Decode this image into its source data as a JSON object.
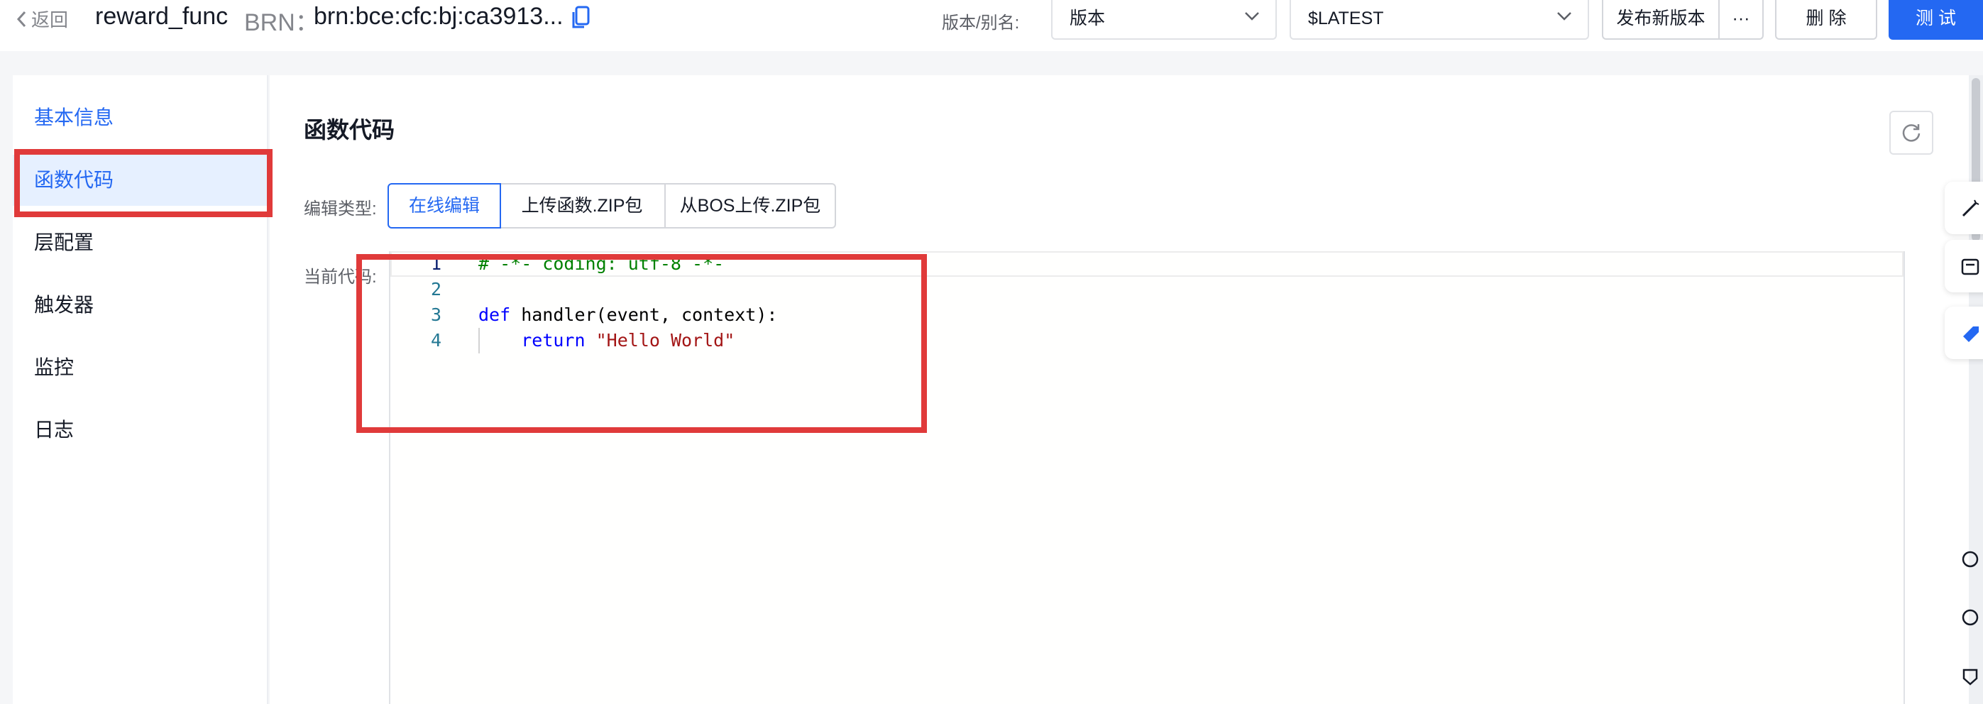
{
  "header": {
    "back_label": "返回",
    "function_name": "reward_func",
    "brn_label": "BRN：",
    "brn_value": "brn:bce:cfc:bj:ca3913...",
    "version_label": "版本/别名:",
    "version_select": "版本",
    "alias_select": "$LATEST",
    "publish_button": "发布新版本",
    "more_button": "···",
    "delete_button": "删 除",
    "test_button": "测 试"
  },
  "sidebar": {
    "items": [
      {
        "label": "基本信息"
      },
      {
        "label": "函数代码"
      },
      {
        "label": "层配置"
      },
      {
        "label": "触发器"
      },
      {
        "label": "监控"
      },
      {
        "label": "日志"
      }
    ]
  },
  "main": {
    "title": "函数代码",
    "edit_type_label": "编辑类型:",
    "edit_types": [
      "在线编辑",
      "上传函数.ZIP包",
      "从BOS上传.ZIP包"
    ],
    "current_code_label": "当前代码:"
  },
  "code_editor": {
    "lines": [
      {
        "number": "1",
        "segments": [
          {
            "text": "# -*- coding: utf-8 -*-",
            "kind": "comment"
          }
        ]
      },
      {
        "number": "2",
        "segments": []
      },
      {
        "number": "3",
        "segments": [
          {
            "text": "def",
            "kind": "kw"
          },
          {
            "text": " handler(event, context):",
            "kind": "plain"
          }
        ]
      },
      {
        "number": "4",
        "segments": [
          {
            "text": "    ",
            "kind": "plain"
          },
          {
            "text": "return",
            "kind": "kw"
          },
          {
            "text": " ",
            "kind": "plain"
          },
          {
            "text": "\"Hello World\"",
            "kind": "str"
          }
        ]
      }
    ]
  },
  "colors": {
    "primary": "#2468f2",
    "highlight_box": "#e03a3a",
    "active_bg": "#e6f0ff"
  }
}
